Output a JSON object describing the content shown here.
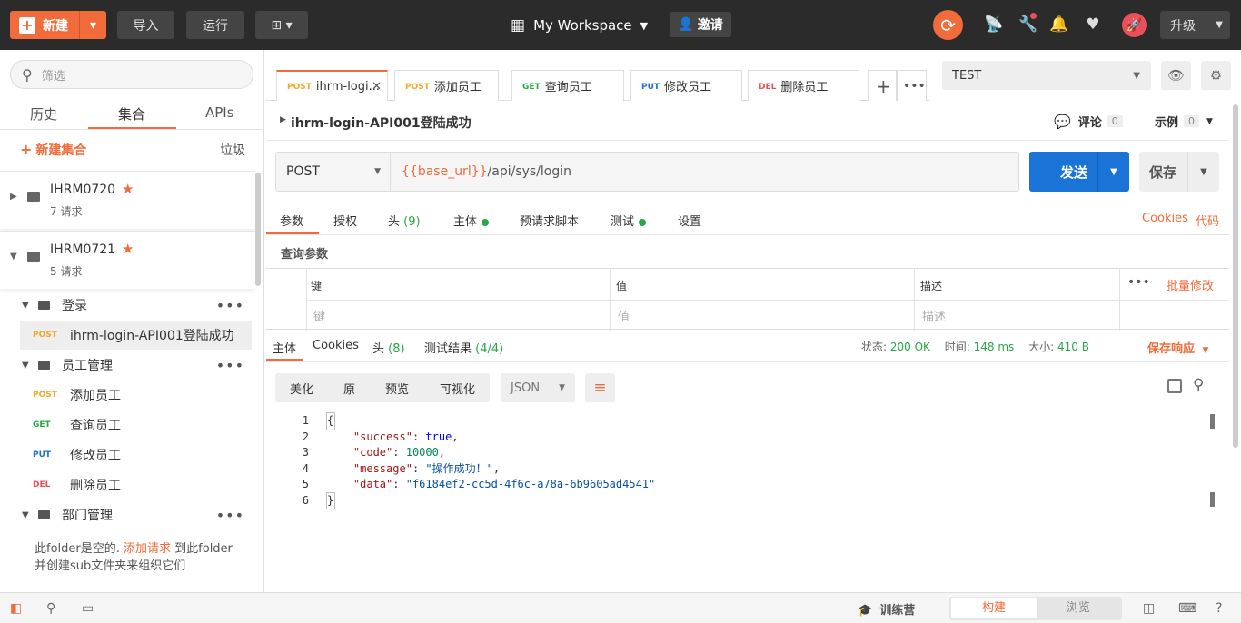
{
  "topbar": {
    "new_label": "新建",
    "import_label": "导入",
    "run_label": "运行",
    "workspace_label": "My Workspace",
    "invite_label": "邀请",
    "upgrade_label": "升级"
  },
  "sidebar": {
    "search_placeholder": "筛选",
    "tabs": [
      "历史",
      "集合",
      "APIs"
    ],
    "new_collection_label": "新建集合",
    "trash_label": "垃圾",
    "collections": [
      {
        "name": "IHRM0720",
        "count": "7 请求"
      },
      {
        "name": "IHRM0721",
        "count": "5 请求"
      }
    ],
    "tree": [
      {
        "type": "folder",
        "label": "登录"
      },
      {
        "type": "request",
        "method": "POST",
        "label": "ihrm-login-API001登陆成功"
      },
      {
        "type": "folder",
        "label": "员工管理"
      },
      {
        "type": "request",
        "method": "POST",
        "label": "添加员工"
      },
      {
        "type": "request",
        "method": "GET",
        "label": "查询员工"
      },
      {
        "type": "request",
        "method": "PUT",
        "label": "修改员工"
      },
      {
        "type": "request",
        "method": "DEL",
        "label": "删除员工"
      },
      {
        "type": "folder",
        "label": "部门管理"
      }
    ],
    "empty_text_1": "此folder是空的. ",
    "empty_link": "添加请求",
    "empty_text_2": " 到此folder并创建sub文件夹来组织它们"
  },
  "tabs": [
    {
      "method": "POST",
      "label": "ihrm-logi..."
    },
    {
      "method": "POST",
      "label": "添加员工"
    },
    {
      "method": "GET",
      "label": "查询员工"
    },
    {
      "method": "PUT",
      "label": "修改员工"
    },
    {
      "method": "DEL",
      "label": "删除员工"
    }
  ],
  "environment": "TEST",
  "request": {
    "title": "ihrm-login-API001登陆成功",
    "comments_label": "评论",
    "comments_count": "0",
    "examples_label": "示例",
    "examples_count": "0",
    "method": "POST",
    "url_var": "{{base_url}}",
    "url_path": "/api/sys/login",
    "send_label": "发送",
    "save_label": "保存",
    "tabs": [
      "参数",
      "授权",
      "头",
      "(9)",
      "主体",
      "预请求脚本",
      "测试",
      "设置"
    ],
    "cookies_label": "Cookies",
    "code_label": "代码",
    "query_title": "查询参数",
    "col_key": "键",
    "col_value": "值",
    "col_desc": "描述",
    "bulk_edit": "批量修改",
    "ph_key": "键",
    "ph_value": "值",
    "ph_desc": "描述"
  },
  "response": {
    "tabs": [
      "主体",
      "Cookies",
      "头",
      "(8)",
      "测试结果",
      "(4/4)"
    ],
    "status_label": "状态:",
    "status_value": "200 OK",
    "time_label": "时间:",
    "time_value": "148 ms",
    "size_label": "大小:",
    "size_value": "410 B",
    "save_response": "保存响应",
    "view_tabs": [
      "美化",
      "原",
      "预览",
      "可视化"
    ],
    "format": "JSON",
    "line_numbers": [
      "1",
      "2",
      "3",
      "4",
      "5",
      "6"
    ],
    "json": {
      "open": "{",
      "k1": "\"success\"",
      "v1": "true",
      "k2": "\"code\"",
      "v2": "10000",
      "k3": "\"message\"",
      "v3": "\"操作成功！\"",
      "k4": "\"data\"",
      "v4": "\"f6184ef2-cc5d-4f6c-a78a-6b9605ad4541\"",
      "close": "}"
    }
  },
  "bottombar": {
    "bootcamp": "训练营",
    "build": "构建",
    "browse": "浏览"
  },
  "colors": {
    "accent": "#f26b3a",
    "post": "#f5a623",
    "get": "#28a745",
    "put": "#1a74d8",
    "del": "#e8505b",
    "send": "#1a74d8"
  }
}
